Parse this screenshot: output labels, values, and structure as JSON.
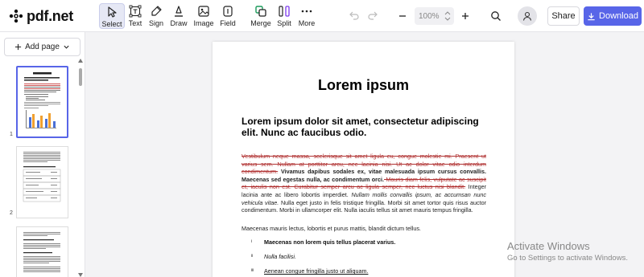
{
  "app": {
    "logo_text": "pdf.net"
  },
  "toolbar": {
    "tools": [
      {
        "id": "select",
        "label": "Select"
      },
      {
        "id": "text",
        "label": "Text"
      },
      {
        "id": "sign",
        "label": "Sign"
      },
      {
        "id": "draw",
        "label": "Draw"
      },
      {
        "id": "image",
        "label": "Image"
      },
      {
        "id": "field",
        "label": "Field"
      },
      {
        "id": "merge",
        "label": "Merge"
      },
      {
        "id": "split",
        "label": "Split"
      },
      {
        "id": "more",
        "label": "More"
      }
    ],
    "zoom": "100%",
    "share_label": "Share",
    "download_label": "Download",
    "accent_color": "#5865e8"
  },
  "sidebar": {
    "add_page_label": "Add page",
    "pages": [
      {
        "number": "1"
      },
      {
        "number": "2"
      }
    ]
  },
  "document": {
    "title": "Lorem ipsum",
    "subtitle": "Lorem ipsum dolor sit amet, consectetur adipiscing elit. Nunc ac faucibus odio.",
    "p1_strike1": "Vestibulum neque massa, scelerisque sit amet ligula eu, congue molestie mi. Praesent ut varius sem. Nullam at porttitor arcu, nec lacinia nisi. Ut ac dolor vitae odio interdum condimentum.",
    "p1_bold": " Vivamus dapibus sodales ex, vitae malesuada ipsum cursus convallis. Maecenas sed egestas nulla, ac condimentum orci.",
    "p1_strike2": " Mauris diam felis, vulputate ac suscipit et, iaculis non est. Curabitur semper arcu ac ligula semper, nec luctus nisi blandit.",
    "p1_plain1": " Integer lacinia ante ac libero lobortis imperdiet. ",
    "p1_italic": "Nullam mollis convallis ipsum, ac accumsan nunc vehicula vitae.",
    "p1_plain2": " Nulla eget justo in felis tristique fringilla. Morbi sit amet tortor quis risus auctor condimentum. Morbi in ullamcorper elit. Nulla iaculis tellus sit amet mauris tempus fringilla.",
    "p2": "Maecenas mauris lectus, lobortis et purus mattis, blandit dictum tellus.",
    "list": [
      {
        "num": "i",
        "text": "Maecenas non lorem quis tellus placerat varius."
      },
      {
        "num": "ii",
        "text": "Nulla facilisi."
      },
      {
        "num": "iii",
        "text": "Aenean congue fringilla justo ut aliquam."
      }
    ]
  },
  "watermark": {
    "line1": "Activate Windows",
    "line2": "Go to Settings to activate Windows."
  }
}
